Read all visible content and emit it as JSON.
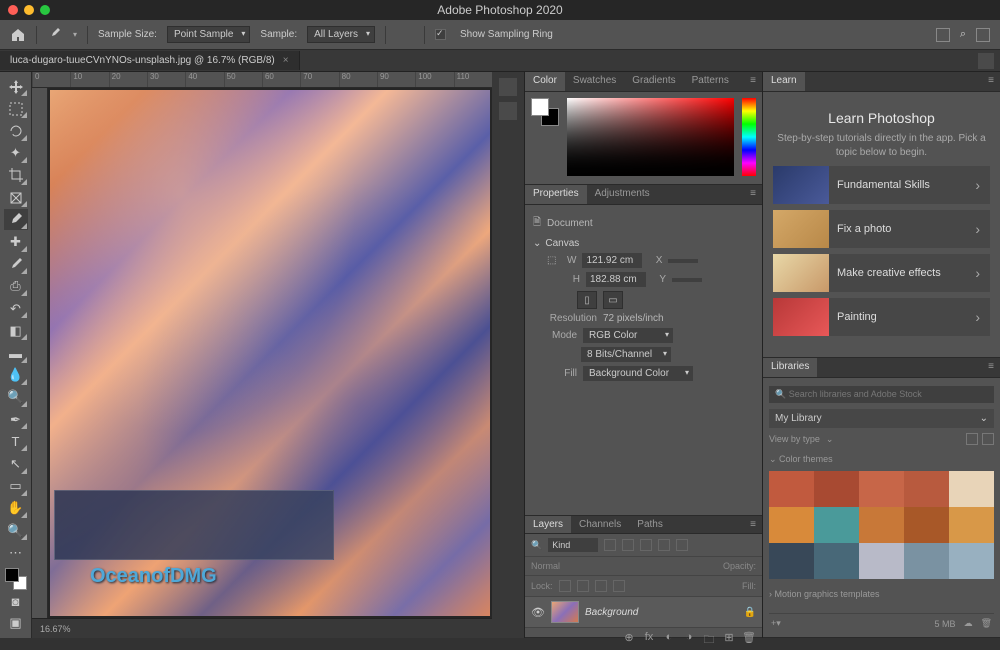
{
  "app": {
    "title": "Adobe Photoshop 2020"
  },
  "optionsBar": {
    "sampleSizeLabel": "Sample Size:",
    "sampleSizeValue": "Point Sample",
    "sampleLabel": "Sample:",
    "sampleValue": "All Layers",
    "showSamplingRing": "Show Sampling Ring"
  },
  "document": {
    "tabTitle": "luca-dugaro-tuueCVnYNOs-unsplash.jpg @ 16.7% (RGB/8)",
    "rulerTicks": [
      "0",
      "10",
      "20",
      "30",
      "40",
      "50",
      "60",
      "70",
      "80",
      "90",
      "100",
      "110"
    ],
    "zoom": "16.67%",
    "watermark": "OceanofDMG"
  },
  "panels": {
    "color": {
      "tabs": [
        "Color",
        "Swatches",
        "Gradients",
        "Patterns"
      ]
    },
    "properties": {
      "tabs": [
        "Properties",
        "Adjustments"
      ],
      "docLabel": "Document",
      "canvasLabel": "Canvas",
      "wLabel": "W",
      "wValue": "121.92 cm",
      "xLabel": "X",
      "hLabel": "H",
      "hValue": "182.88 cm",
      "yLabel": "Y",
      "resLabel": "Resolution",
      "resValue": "72 pixels/inch",
      "modeLabel": "Mode",
      "modeValue": "RGB Color",
      "depthValue": "8 Bits/Channel",
      "fillLabel": "Fill",
      "fillValue": "Background Color"
    },
    "layers": {
      "tabs": [
        "Layers",
        "Channels",
        "Paths"
      ],
      "kind": "Kind",
      "blend": "Normal",
      "opacityLabel": "Opacity:",
      "lockLabel": "Lock:",
      "fillLabel": "Fill:",
      "layerName": "Background"
    },
    "learn": {
      "tab": "Learn",
      "heading": "Learn Photoshop",
      "sub": "Step-by-step tutorials directly in the app. Pick a topic below to begin.",
      "cards": [
        "Fundamental Skills",
        "Fix a photo",
        "Make creative effects",
        "Painting"
      ]
    },
    "libraries": {
      "tab": "Libraries",
      "searchPlaceholder": "Search libraries and Adobe Stock",
      "libName": "My Library",
      "viewBy": "View by type",
      "groupLabel": "Color themes",
      "motion": "Motion graphics templates",
      "size": "5 MB",
      "swatches": [
        [
          "#c15a3e",
          "#a84a32",
          "#c76648",
          "#b85a3e",
          "#e8d4b8"
        ],
        [
          "#d88a3a",
          "#4a9a9a",
          "#c87838",
          "#a85828",
          "#d89848"
        ],
        [
          "#384858",
          "#486878",
          "#b8bac8",
          "#7a92a2",
          "#98b0c0"
        ]
      ]
    }
  }
}
